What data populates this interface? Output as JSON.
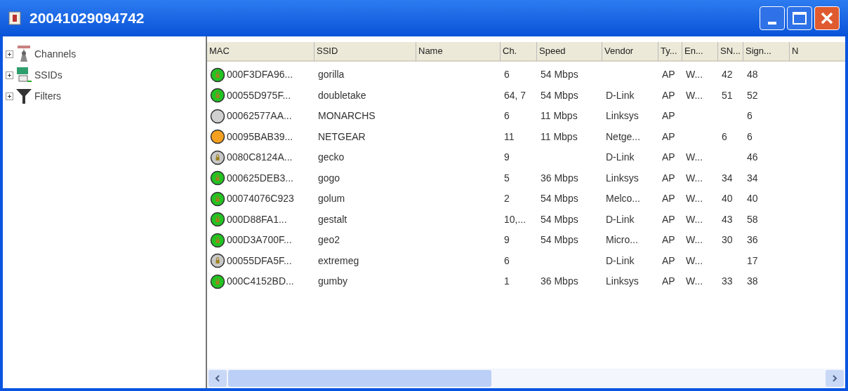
{
  "window": {
    "title": "20041029094742"
  },
  "tree": [
    {
      "label": "Channels",
      "expanded": false,
      "kind": "tower"
    },
    {
      "label": "SSIDs",
      "expanded": false,
      "kind": "network"
    },
    {
      "label": "Filters",
      "expanded": false,
      "kind": "filter"
    }
  ],
  "table": {
    "columns": [
      "MAC",
      "SSID",
      "Name",
      "Ch.",
      "Speed",
      "Vendor",
      "Ty...",
      "En...",
      "SN...",
      "Sign...",
      "N"
    ],
    "rows": [
      {
        "color": "#22c322",
        "secured": true,
        "cells": [
          "000F3DFA96...",
          "gorilla",
          "",
          "6",
          "54 Mbps",
          "",
          "AP",
          "W...",
          "42",
          "48"
        ]
      },
      {
        "color": "#22c322",
        "secured": true,
        "cells": [
          "00055D975F...",
          "doubletake",
          "",
          "64, 7",
          "54 Mbps",
          "D-Link",
          "AP",
          "W...",
          "51",
          "52"
        ]
      },
      {
        "color": "#d0d0d0",
        "secured": false,
        "cells": [
          "00062577AA...",
          "MONARCHS",
          "",
          "6",
          "11 Mbps",
          "Linksys",
          "AP",
          "",
          "",
          "6"
        ]
      },
      {
        "color": "#f5a020",
        "secured": false,
        "cells": [
          "00095BAB39...",
          "NETGEAR",
          "",
          "11",
          "11 Mbps",
          "Netge...",
          "AP",
          "",
          "6",
          "6"
        ]
      },
      {
        "color": "#c8c8c8",
        "secured": true,
        "cells": [
          "0080C8124A...",
          "gecko",
          "",
          "9",
          "",
          "D-Link",
          "AP",
          "W...",
          "",
          "46"
        ]
      },
      {
        "color": "#22c322",
        "secured": true,
        "cells": [
          "000625DEB3...",
          "gogo",
          "",
          "5",
          "36 Mbps",
          "Linksys",
          "AP",
          "W...",
          "34",
          "34"
        ]
      },
      {
        "color": "#22c322",
        "secured": true,
        "cells": [
          "00074076C923",
          "golum",
          "",
          "2",
          "54 Mbps",
          "Melco...",
          "AP",
          "W...",
          "40",
          "40"
        ]
      },
      {
        "color": "#22c322",
        "secured": true,
        "cells": [
          "000D88FA1...",
          "gestalt",
          "",
          "10,...",
          "54 Mbps",
          "D-Link",
          "AP",
          "W...",
          "43",
          "58"
        ]
      },
      {
        "color": "#22c322",
        "secured": true,
        "cells": [
          "000D3A700F...",
          "geo2",
          "",
          "9",
          "54 Mbps",
          "Micro...",
          "AP",
          "W...",
          "30",
          "36"
        ]
      },
      {
        "color": "#c8c8c8",
        "secured": true,
        "cells": [
          "00055DFA5F...",
          "extremeg",
          "",
          "6",
          "",
          "D-Link",
          "AP",
          "W...",
          "",
          "17"
        ]
      },
      {
        "color": "#22c322",
        "secured": true,
        "cells": [
          "000C4152BD...",
          "gumby",
          "",
          "1",
          "36 Mbps",
          "Linksys",
          "AP",
          "W...",
          "33",
          "38"
        ]
      }
    ]
  }
}
